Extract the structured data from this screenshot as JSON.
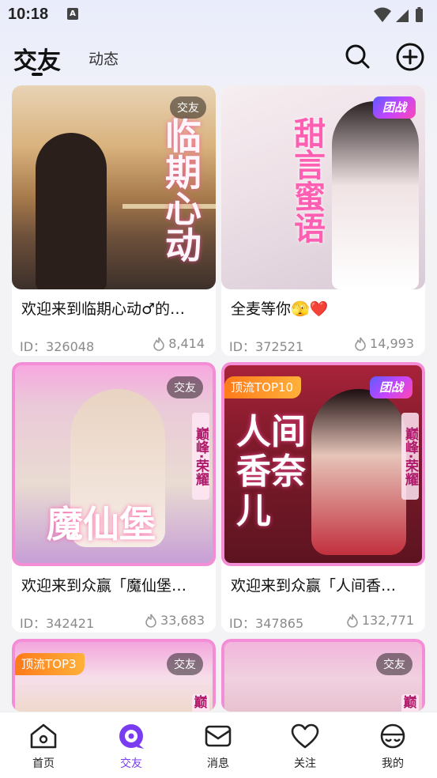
{
  "status_bar": {
    "time": "10:18",
    "a_icon": "A"
  },
  "header": {
    "active_tab": "交友",
    "inactive_tab": "动态"
  },
  "cards": [
    {
      "title": "欢迎来到临期心动♂的…",
      "id_text": "ID：326048",
      "heat": "8,414",
      "badge": "交友",
      "poster_text": "临期心动"
    },
    {
      "title": "全麦等你🫣❤️",
      "id_text": "ID：372521",
      "heat": "14,993",
      "badge": "团战",
      "poster_text": "甜言蜜语"
    },
    {
      "title": "欢迎来到众赢「魔仙堡…",
      "id_text": "ID：342421",
      "heat": "33,683",
      "badge": "交友",
      "poster_text": "魔仙堡",
      "side_text": "巅峰·荣耀"
    },
    {
      "title": "欢迎来到众赢「人间香…",
      "id_text": "ID：347865",
      "heat": "132,771",
      "badge": "团战",
      "top_badge": "顶流TOP10",
      "poster_text": "人间香奈儿",
      "side_text": "巅峰·荣耀"
    },
    {
      "badge": "交友",
      "top_badge": "顶流TOP3",
      "side_text": "巅"
    },
    {
      "badge": "交友",
      "side_text": "巅"
    }
  ],
  "bottom_nav": [
    {
      "label": "首页",
      "icon": "home-icon"
    },
    {
      "label": "交友",
      "icon": "chat-bubble-icon"
    },
    {
      "label": "消息",
      "icon": "mail-icon"
    },
    {
      "label": "关注",
      "icon": "heart-icon"
    },
    {
      "label": "我的",
      "icon": "profile-icon"
    }
  ],
  "colors": {
    "accent": "#7a3cf0",
    "top_badge": "#ff8a1f",
    "team_badge": "#c146ff"
  }
}
